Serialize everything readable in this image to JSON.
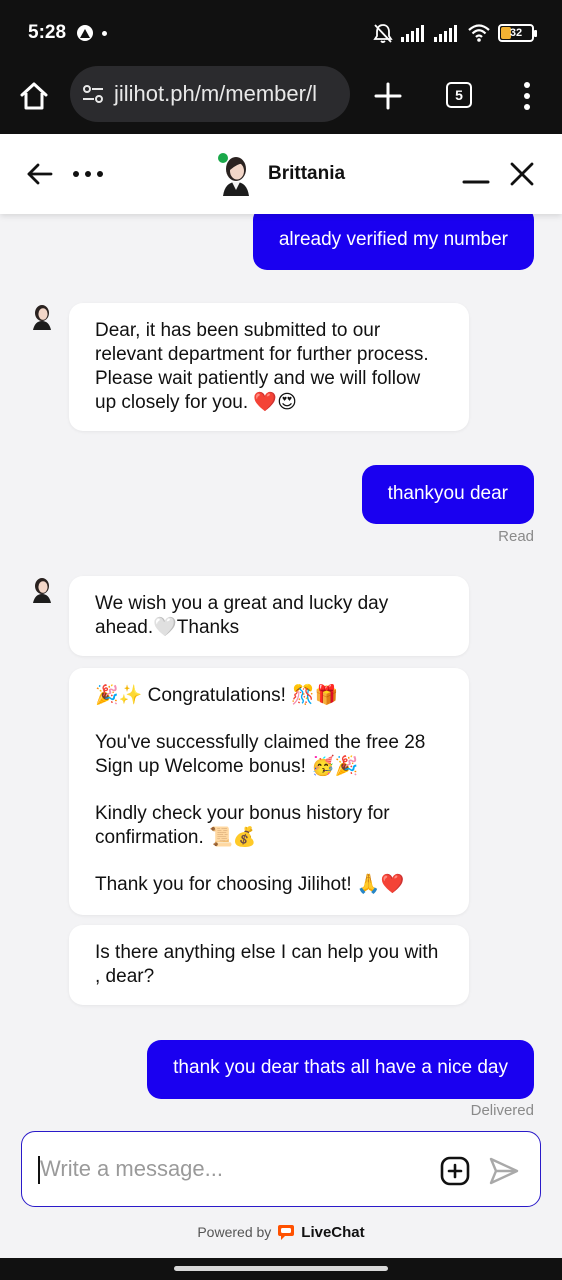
{
  "status_bar": {
    "time": "5:28",
    "battery_level": "32",
    "battery_fraction": 0.32,
    "colors": {
      "battery_fill": "#f2b233"
    }
  },
  "browser": {
    "url": "jilihot.ph/m/member/l",
    "tab_count": "5",
    "icons": [
      "home-icon",
      "site-settings-icon",
      "new-tab-icon",
      "tab-switcher-icon",
      "overflow-menu-icon"
    ]
  },
  "chat_header": {
    "agent_name": "Brittania",
    "agent_online": true,
    "icons": [
      "back-arrow-icon",
      "more-dots-icon",
      "minimize-icon",
      "close-icon"
    ],
    "colors": {
      "online": "#1aa84a"
    }
  },
  "messages": [
    {
      "side": "out",
      "text": "already verified my number"
    },
    {
      "side": "in",
      "text": "Dear, it has been submitted to our relevant department for further process. Please wait patiently and we will follow up closely for you. ❤️😍"
    },
    {
      "side": "out",
      "text": "thankyou dear",
      "status": "Read"
    },
    {
      "side": "in",
      "text": "We wish you a great and lucky day ahead.🤍Thanks"
    },
    {
      "side": "in",
      "paragraphs": [
        "🎉✨ Congratulations! 🎊🎁",
        "You've successfully claimed the free 28 Sign up Welcome bonus! 🥳🎉",
        "Kindly check your bonus history for confirmation. 📜💰",
        "Thank you for choosing Jilihot! 🙏❤️"
      ]
    },
    {
      "side": "in",
      "text": "Is there anything else I can help you with , dear?"
    },
    {
      "side": "out",
      "text": "thank you dear thats all have a nice day",
      "status": "Delivered"
    }
  ],
  "composer": {
    "placeholder": "Write a message...",
    "icons": [
      "attach-plus-icon",
      "send-icon"
    ]
  },
  "footer": {
    "powered_by": "Powered by",
    "brand": "LiveChat",
    "colors": {
      "brand": "#ff5100"
    }
  },
  "colors": {
    "outgoing_bubble": "#1a00f0",
    "incoming_bubble": "#ffffff",
    "chat_background": "#f3f3f5",
    "composer_border": "#2a1ac9"
  }
}
